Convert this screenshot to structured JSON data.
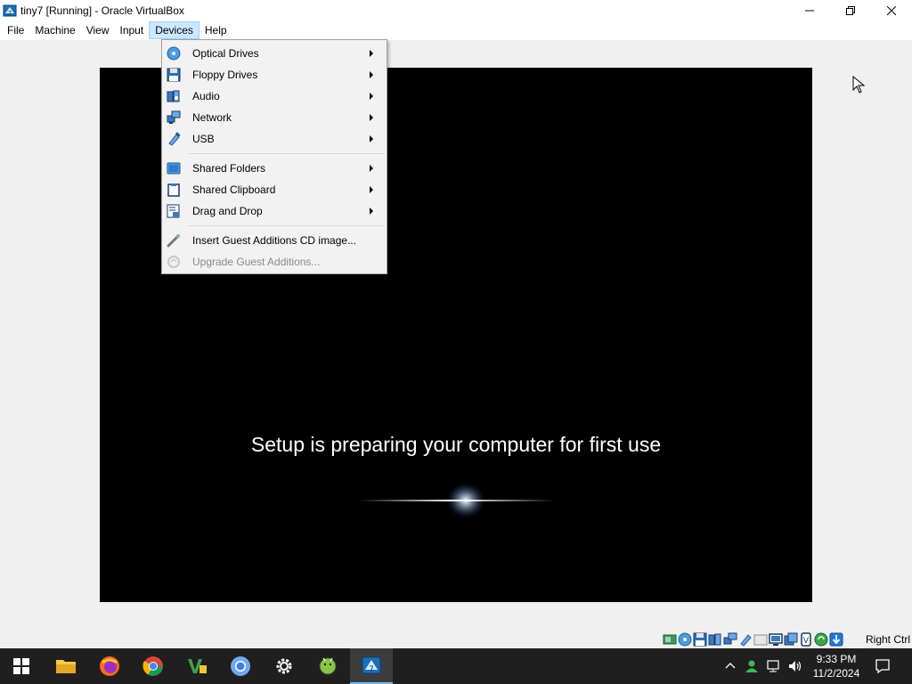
{
  "window": {
    "title": "tiny7 [Running] - Oracle VirtualBox",
    "minimize_icon": "minimize-icon",
    "restore_icon": "restore-icon",
    "close_icon": "close-icon"
  },
  "menubar": {
    "items": [
      {
        "label": "File"
      },
      {
        "label": "Machine"
      },
      {
        "label": "View"
      },
      {
        "label": "Input"
      },
      {
        "label": "Devices",
        "active": true
      },
      {
        "label": "Help"
      }
    ]
  },
  "devices_menu": {
    "items": [
      {
        "label": "Optical Drives",
        "icon": "optical-drive-icon",
        "submenu": true
      },
      {
        "label": "Floppy Drives",
        "icon": "floppy-drive-icon",
        "submenu": true
      },
      {
        "label": "Audio",
        "icon": "audio-icon",
        "submenu": true
      },
      {
        "label": "Network",
        "icon": "network-icon",
        "submenu": true
      },
      {
        "label": "USB",
        "icon": "usb-icon",
        "submenu": true
      },
      {
        "label": "Shared Folders",
        "icon": "shared-folders-icon",
        "submenu": true
      },
      {
        "label": "Shared Clipboard",
        "icon": "shared-clipboard-icon",
        "submenu": true
      },
      {
        "label": "Drag and Drop",
        "icon": "drag-and-drop-icon",
        "submenu": true
      },
      {
        "label": "Insert Guest Additions CD image...",
        "icon": "guest-additions-icon",
        "submenu": false
      },
      {
        "label": "Upgrade Guest Additions...",
        "icon": "upgrade-guest-additions-icon",
        "submenu": false,
        "disabled": true
      }
    ]
  },
  "vm": {
    "message": "Setup is preparing your computer for first use"
  },
  "statusbar": {
    "icons": [
      "hard-disk-icon",
      "optical-drive-icon",
      "floppy-drive-icon",
      "audio-icon",
      "network-icon",
      "usb-icon",
      "shared-folders-icon",
      "display-icon",
      "recording-icon",
      "cpu-icon",
      "mouse-integration-icon",
      "keyboard-icon"
    ],
    "host_key": "Right Ctrl"
  },
  "taskbar": {
    "apps": [
      "windows-start-icon",
      "file-explorer-icon",
      "firefox-icon",
      "chrome-icon",
      "visual-studio-icon",
      "chromium-icon",
      "settings-icon",
      "android-studio-icon",
      "virtualbox-icon"
    ],
    "time": "9:33 PM",
    "date": "11/2/2024"
  },
  "colors": {
    "menu_highlight": "#cce8ff",
    "taskbar_bg": "#1f1f1f",
    "vm_bg": "#000000"
  }
}
